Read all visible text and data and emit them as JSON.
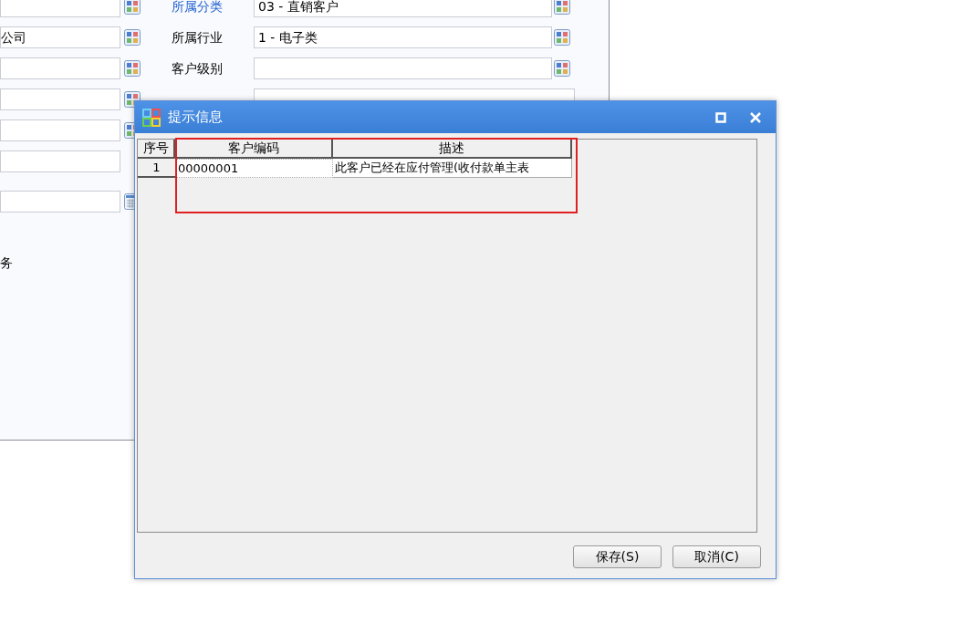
{
  "form": {
    "left_rows": [
      {
        "value": "",
        "kind": "lookup"
      },
      {
        "value": "公司",
        "kind": "lookup"
      },
      {
        "value": "",
        "kind": "lookup"
      },
      {
        "value": "",
        "kind": "lookup"
      },
      {
        "value": "",
        "kind": "lookup"
      },
      {
        "value": "",
        "kind": "plain"
      },
      {
        "value": "",
        "kind": "date"
      }
    ],
    "left_label": "务",
    "right_rows": [
      {
        "label": "所属分类",
        "value": "03 - 直销客户",
        "kind": "lookup",
        "link": true
      },
      {
        "label": "所属行业",
        "value": "1 - 电子类",
        "kind": "lookup",
        "link": false
      },
      {
        "label": "客户级别",
        "value": "",
        "kind": "lookup",
        "link": false
      },
      {
        "value": "",
        "kind": "plain"
      }
    ]
  },
  "dialog": {
    "title": "提示信息",
    "table": {
      "columns": [
        "序号",
        "客户编码",
        "描述"
      ],
      "rows": [
        {
          "cells": [
            "1",
            "00000001",
            "此客户已经在应付管理(收付款单主表"
          ],
          "selected": true
        }
      ]
    },
    "buttons": [
      "保存(S)",
      "取消(C)"
    ]
  }
}
